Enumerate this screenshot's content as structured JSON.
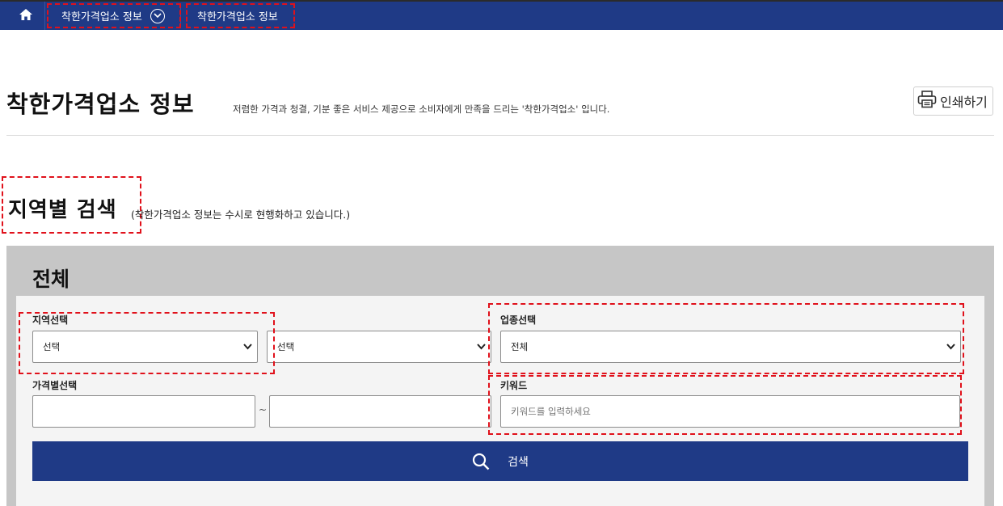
{
  "nav": {
    "home_icon": "home-icon",
    "crumb1": "착한가격업소 정보",
    "crumb2": "착한가격업소 정보"
  },
  "header": {
    "title": "착한가격업소 정보",
    "description": "저렴한 가격과 청결, 기분 좋은 서비스 제공으로 소비자에게 만족을 드리는 '착한가격업소' 입니다.",
    "print_label": "인쇄하기"
  },
  "section": {
    "title": "지역별 검색",
    "note": "(착한가격업소 정보는 수시로 현행화하고 있습니다.)"
  },
  "search": {
    "panel_title": "전체",
    "region_label": "지역선택",
    "region_select1": "선택",
    "region_select2": "선택",
    "business_label": "업종선택",
    "business_select": "전체",
    "price_label": "가격별선택",
    "price_from": "",
    "price_to": "",
    "price_separator": "~",
    "keyword_label": "키워드",
    "keyword_placeholder": "키워드를 입력하세요",
    "button_label": "검색"
  },
  "colors": {
    "brand": "#1f3a86",
    "highlight": "#e0111b",
    "panel": "#c6c6c6"
  }
}
